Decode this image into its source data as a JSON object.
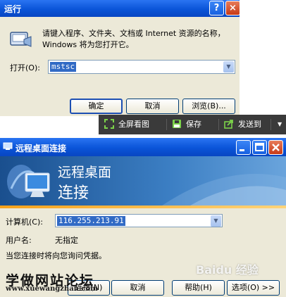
{
  "run_dialog": {
    "title": "运行",
    "help_button": "?",
    "close_button": "×",
    "description": "请键入程序、文件夹、文档或 Internet 资源的名称，Windows 将为您打开它。",
    "open_label": "打开(O):",
    "open_value": "mstsc",
    "ok_label": "确定",
    "cancel_label": "取消",
    "browse_label": "浏览(B)..."
  },
  "viewer_toolbar": {
    "fullscreen_label": "全屏看图",
    "save_label": "保存",
    "sendto_label": "发送到"
  },
  "rdp": {
    "title": "远程桌面连接",
    "banner_line1": "远程桌面",
    "banner_line2": "连接",
    "computer_label": "计算机(C):",
    "computer_value": "116.255.213.91",
    "username_label": "用户名:",
    "username_value": "无指定",
    "credentials_note": "当您连接时将向您询问凭据。",
    "connect_label": "连接(N)",
    "cancel_label": "取消",
    "help_label": "帮助(H)",
    "options_label": "选项(O) >>"
  },
  "watermarks": {
    "site_name": "学做网站论坛",
    "site_url": "www.xuewangzhan.com",
    "baidu": "Baidu 经验"
  },
  "colors": {
    "xp_title_blue": "#0a54d8",
    "dialog_bg": "#ece9d8",
    "selection_blue": "#316ac5",
    "toolbar_dark": "#3a3a3a"
  }
}
